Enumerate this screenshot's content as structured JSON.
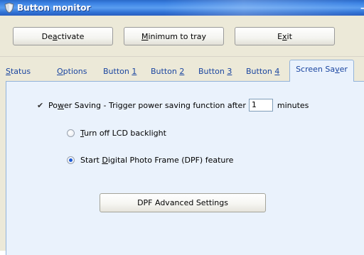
{
  "window": {
    "title": "Button monitor",
    "minimize_glyph": "–"
  },
  "toolbar": {
    "deactivate": {
      "pre": "De",
      "key": "a",
      "post": "ctivate"
    },
    "minimize": {
      "pre": "",
      "key": "M",
      "post": "inimum to tray"
    },
    "exit": {
      "pre": "E",
      "key": "x",
      "post": "it"
    }
  },
  "tabs": [
    {
      "pre": "",
      "key": "S",
      "post": "tatus"
    },
    {
      "pre": "",
      "key": "O",
      "post": "ptions"
    },
    {
      "pre": "Button ",
      "key": "1",
      "post": ""
    },
    {
      "pre": "Button ",
      "key": "2",
      "post": ""
    },
    {
      "pre": "Button ",
      "key": "3",
      "post": ""
    },
    {
      "pre": "Button ",
      "key": "4",
      "post": ""
    },
    {
      "pre": "Screen Sa",
      "key": "v",
      "post": "er"
    }
  ],
  "screen_saver": {
    "power_saving": {
      "checked": true,
      "pre": "Po",
      "key": "w",
      "post": "er Saving - Trigger power saving function after",
      "minutes_value": "1",
      "minutes_label": "minutes"
    },
    "options": [
      {
        "pre": "",
        "key": "T",
        "post": "urn off LCD backlight",
        "selected": false
      },
      {
        "pre": "Start ",
        "key": "D",
        "post": "igital Photo Frame (DPF) feature",
        "selected": true
      }
    ],
    "advanced_button": "DPF Advanced Settings"
  },
  "icons": {
    "app": "shield-icon",
    "checkbox": "checkmark-icon"
  },
  "colors": {
    "titlebar": "#3b82e3",
    "tab_text": "#1a45a0",
    "panel_bg": "#eaf2fc",
    "window_bg": "#ece9d8"
  }
}
